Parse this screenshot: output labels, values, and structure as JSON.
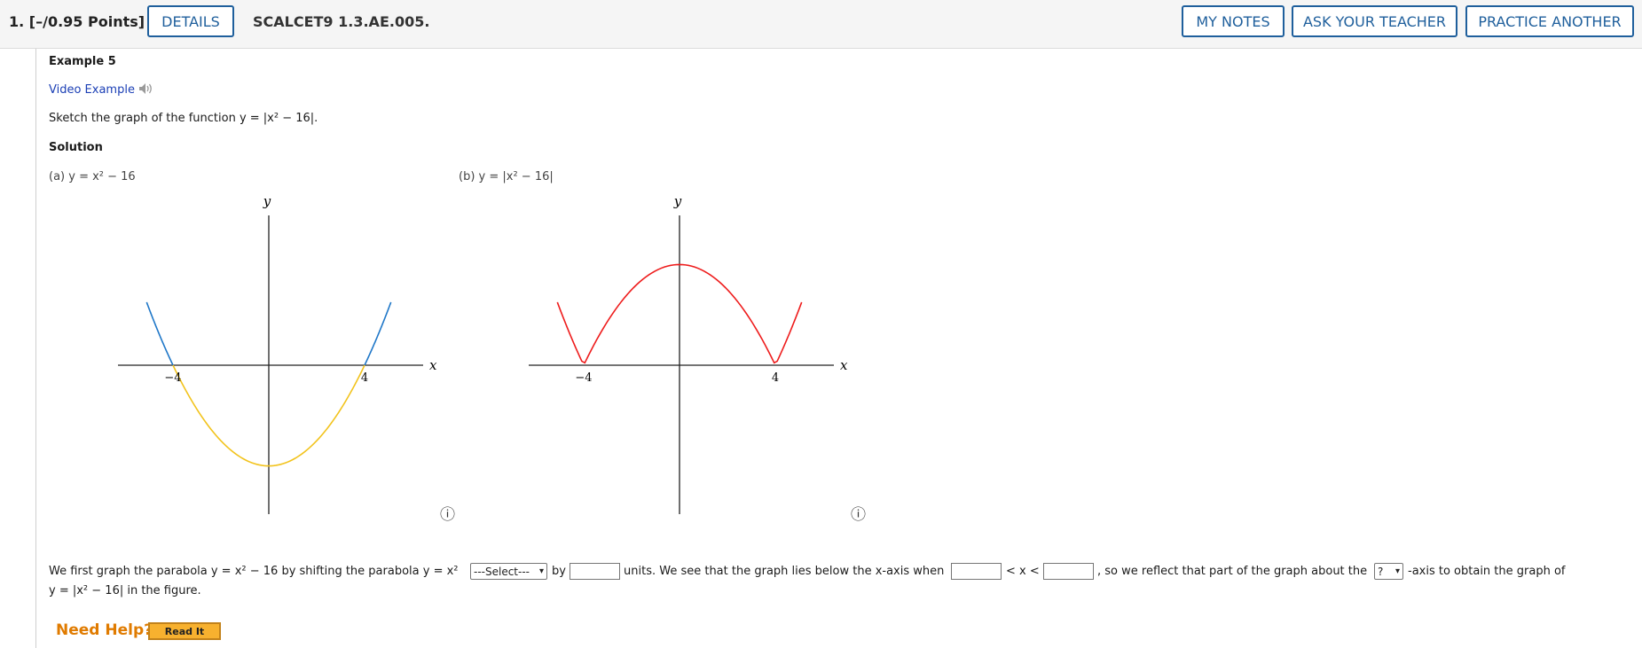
{
  "header": {
    "question_number": "1.  [–/0.95 Points]",
    "details_label": "DETAILS",
    "problem_code": "SCALCET9 1.3.AE.005.",
    "my_notes_label": "MY NOTES",
    "ask_teacher_label": "ASK YOUR TEACHER",
    "practice_label": "PRACTICE ANOTHER"
  },
  "content": {
    "example_title": "Example 5",
    "video_link": "Video Example",
    "prompt": "Sketch the graph of the function y = |x² − 16|.",
    "solution_label": "Solution",
    "graph_a_caption": "(a)  y = x² − 16",
    "graph_b_caption": "(b)  y = |x² − 16|"
  },
  "graphs": {
    "y_axis_label": "y",
    "x_axis_label": "x",
    "a_tick_neg": "−4",
    "a_tick_pos": "4",
    "b_tick_neg": "−4",
    "b_tick_pos": "4",
    "info_icon": "ⓘ"
  },
  "sentence": {
    "part1": "We first graph the parabola y = x² − 16 by shifting the parabola y = x²",
    "shift_select_value": "---Select---",
    "by": "by",
    "part2": "units. We see that the graph lies below the x-axis when",
    "lt": "< x <",
    "part3": ", so we reflect that part of the graph about the",
    "axis_select_value": "?",
    "part4": "-axis to obtain the graph of",
    "line2": "y = |x² − 16| in the figure."
  },
  "help": {
    "need_help": "Need Help?",
    "read_it": "Read It"
  },
  "colors": {
    "button_blue": "#1f5f9c",
    "blue_curve": "#1f77c8",
    "yellow_curve": "#f2c31c",
    "red_curve": "#ee1c1c",
    "help_orange": "#e07b00"
  }
}
